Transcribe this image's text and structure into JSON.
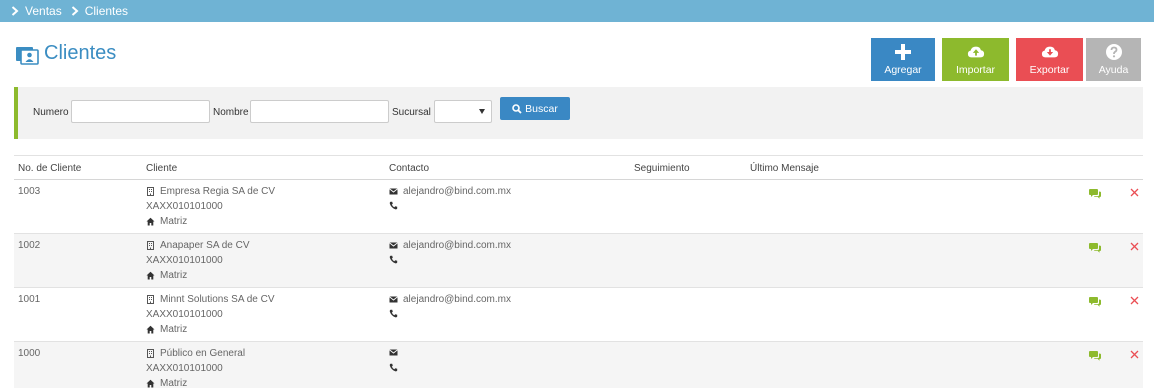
{
  "breadcrumb": {
    "items": [
      "Ventas",
      "Clientes"
    ]
  },
  "page": {
    "title": "Clientes"
  },
  "actions": {
    "agregar": "Agregar",
    "importar": "Importar",
    "exportar": "Exportar",
    "ayuda": "Ayuda"
  },
  "filters": {
    "numero_label": "Numero",
    "numero_value": "",
    "nombre_label": "Nombre",
    "nombre_value": "",
    "sucursal_label": "Sucursal",
    "sucursal_value": "",
    "buscar_label": "Buscar"
  },
  "table": {
    "headers": [
      "No. de Cliente",
      "Cliente",
      "Contacto",
      "Seguimiento",
      "Último Mensaje"
    ],
    "rows": [
      {
        "number": "1003",
        "name": "Empresa Regia SA de CV",
        "rfc": "XAXX010101000",
        "branch": "Matriz",
        "email": "alejandro@bind.com.mx",
        "phone": "",
        "followup": "",
        "last_message": ""
      },
      {
        "number": "1002",
        "name": "Anapaper SA de CV",
        "rfc": "XAXX010101000",
        "branch": "Matriz",
        "email": "alejandro@bind.com.mx",
        "phone": "",
        "followup": "",
        "last_message": ""
      },
      {
        "number": "1001",
        "name": "Minnt Solutions SA de CV",
        "rfc": "XAXX010101000",
        "branch": "Matriz",
        "email": "alejandro@bind.com.mx",
        "phone": "",
        "followup": "",
        "last_message": ""
      },
      {
        "number": "1000",
        "name": "Público en General",
        "rfc": "XAXX010101000",
        "branch": "Matriz",
        "email": "",
        "phone": "",
        "followup": "",
        "last_message": ""
      }
    ]
  },
  "icons": {
    "breadcrumb_separator": "chevron-right-icon",
    "title": "clients-icon",
    "agregar": "plus-icon",
    "importar": "cloud-upload-icon",
    "exportar": "cloud-download-icon",
    "ayuda": "question-icon",
    "buscar": "search-icon",
    "client": "building-icon",
    "branch": "home-icon",
    "email": "envelope-icon",
    "phone": "phone-icon",
    "chat": "comments-icon",
    "delete": "close-icon"
  },
  "colors": {
    "header_bar": "#6fb3d4",
    "title": "#3b8dc2",
    "agregar": "#3a88c4",
    "importar": "#8dba2d",
    "exportar": "#ea4e54",
    "ayuda": "#b5b5b5",
    "chat": "#8dba2d",
    "delete": "#ea4e54"
  }
}
